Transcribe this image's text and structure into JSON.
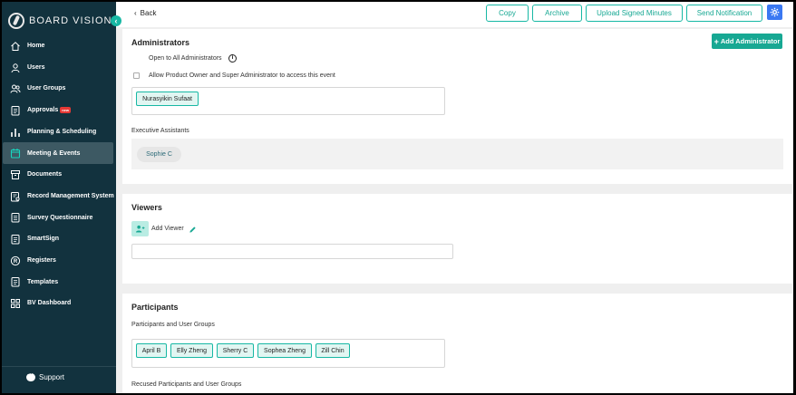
{
  "sidebar": {
    "brand": "BOARD VISION",
    "collapse_icon": "chevron-left-icon",
    "items": [
      {
        "label": "Home",
        "icon": "home-icon"
      },
      {
        "label": "Users",
        "icon": "user-icon"
      },
      {
        "label": "User Groups",
        "icon": "users-icon"
      },
      {
        "label": "Approvals",
        "icon": "approvals-icon",
        "badge": "new"
      },
      {
        "label": "Planning & Scheduling",
        "icon": "bar-chart-icon"
      },
      {
        "label": "Meeting & Events",
        "icon": "calendar-icon",
        "active": true
      },
      {
        "label": "Documents",
        "icon": "document-box-icon"
      },
      {
        "label": "Record Management System",
        "icon": "record-icon"
      },
      {
        "label": "Survey Questionnaire",
        "icon": "survey-icon"
      },
      {
        "label": "SmartSign",
        "icon": "smartsign-icon"
      },
      {
        "label": "Registers",
        "icon": "registered-icon"
      },
      {
        "label": "Templates",
        "icon": "template-icon"
      },
      {
        "label": "BV Dashboard",
        "icon": "dashboard-grid-icon"
      }
    ],
    "support_label": "Support"
  },
  "topbar": {
    "back_label": "Back",
    "buttons": [
      "Copy",
      "Archive",
      "Upload Signed Minutes",
      "Send Notification"
    ],
    "settings_icon": "gear-icon"
  },
  "administrators": {
    "title": "Administrators",
    "add_button": "Add Administrator",
    "open_to_all": "Open to All Administrators",
    "allow_label": "Allow Product Owner and Super Administrator to access this event",
    "chips": [
      "Nurasyikin Sufaat"
    ],
    "exec_assistants_label": "Executive Assistants",
    "exec_assistants": [
      "Sophie C"
    ]
  },
  "viewers": {
    "title": "Viewers",
    "add_label": "Add Viewer"
  },
  "participants": {
    "title": "Participants",
    "groups_label": "Participants and User Groups",
    "chips": [
      "April B",
      "Elly Zheng",
      "Sherry C",
      "Sophea Zheng",
      "Zill Chin"
    ],
    "recused_label": "Recused Participants and User Groups"
  },
  "colors": {
    "sidebar_bg": "#12323e",
    "accent": "#17b8a4",
    "settings_blue": "#3a78f2"
  }
}
